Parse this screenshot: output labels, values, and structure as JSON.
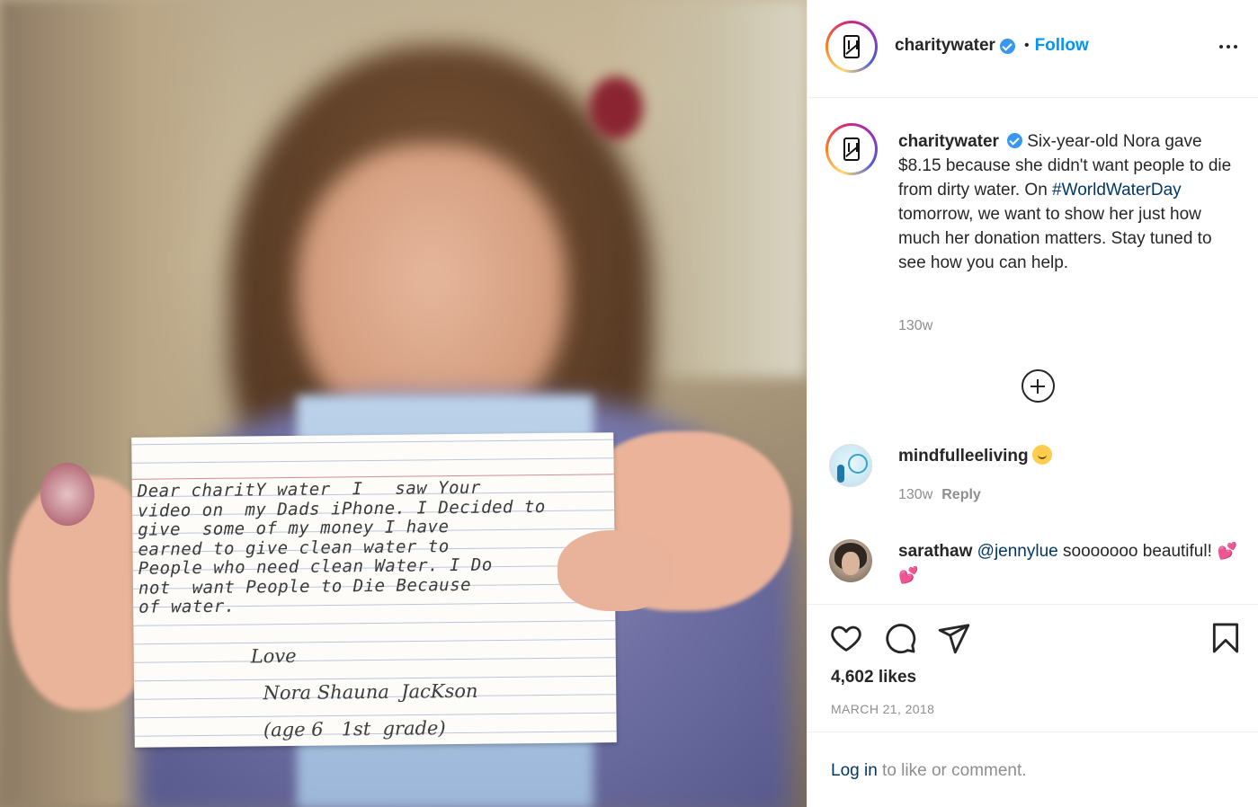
{
  "post": {
    "username": "charitywater",
    "follow_label": "Follow",
    "dot": "•",
    "caption_user": "charitywater",
    "caption_part1": "Six-year-old Nora gave $8.15 because she didn't want people to die from dirty water. On ",
    "hashtag": "#WorldWaterDay",
    "caption_part2": " tomorrow, we want to show her just how much her donation matters. Stay tuned to see how you can help.",
    "caption_time": "130w"
  },
  "photo": {
    "note_text": "Dear charitY water  I   saw Your\nvideo on  my Dads iPhone. I Decided to\ngive  some of my money I have\nearned to give clean water to\nPeople who need clean Water. I Do\nnot  want People to Die Because\nof water.",
    "signature": "Love\n  Nora Shauna  JacKson\n  (age 6   1st  grade)"
  },
  "comments": [
    {
      "username": "mindfulleeliving",
      "text": "",
      "time": "130w",
      "reply_label": "Reply"
    },
    {
      "username": "sarathaw",
      "mention": "@jennylue",
      "text": " sooooooo beautiful!",
      "hearts": "💕💕"
    }
  ],
  "actions": {
    "likes": "4,602 likes",
    "date": "MARCH 21, 2018"
  },
  "login": {
    "link": "Log in",
    "rest": " to like or comment."
  },
  "icons": {
    "verified": "verified-badge-icon",
    "more": "more-options-icon",
    "expand": "plus-circle-icon",
    "like": "heart-icon",
    "comment": "comment-bubble-icon",
    "share": "paper-plane-icon",
    "save": "bookmark-icon"
  },
  "colors": {
    "accent": "#0095f6",
    "link": "#00376b",
    "verified": "#3897f0",
    "muted": "#8e8e8e"
  }
}
